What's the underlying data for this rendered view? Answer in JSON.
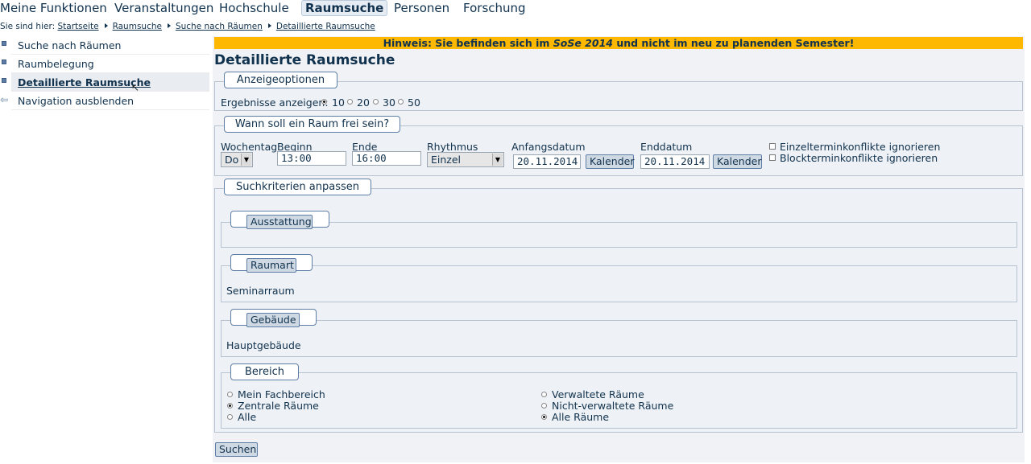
{
  "topnav": {
    "items": [
      "Meine Funktionen",
      "Veranstaltungen",
      "Hochschule",
      "Raumsuche",
      "Personen",
      "Forschung"
    ],
    "active": "Raumsuche"
  },
  "breadcrumb": {
    "prefix": "Sie sind hier:",
    "items": [
      "Startseite",
      "Raumsuche",
      "Suche nach Räumen",
      "Detaillierte Raumsuche"
    ]
  },
  "sidebar": {
    "items": [
      {
        "label": "Suche nach Räumen"
      },
      {
        "label": "Raumbelegung"
      },
      {
        "label": "Detaillierte Raumsuche"
      },
      {
        "label": "Navigation ausblenden"
      }
    ]
  },
  "notice": {
    "prefix": "Hinweis: Sie befinden sich im ",
    "semester": "SoSe 2014",
    "suffix": " und nicht im neu zu planenden Semester!"
  },
  "page_title": "Detaillierte Raumsuche",
  "display_options": {
    "legend": "Anzeigeoptionen",
    "label": "Ergebnisse anzeigen:",
    "options": [
      "10",
      "20",
      "30",
      "50"
    ],
    "selected": "10"
  },
  "when": {
    "legend": "Wann soll ein Raum frei sein?",
    "weekday_label": "Wochentag",
    "weekday_value": "Do",
    "begin_label": "Beginn",
    "begin_value": "13:00",
    "end_label": "Ende",
    "end_value": "16:00",
    "rhythm_label": "Rhythmus",
    "rhythm_value": "Einzel",
    "start_date_label": "Anfangsdatum",
    "start_date_value": "20.11.2014",
    "end_date_label": "Enddatum",
    "end_date_value": "20.11.2014",
    "calendar_button": "Kalender",
    "ignore_single": "Einzelterminkonflikte ignorieren",
    "ignore_block": "Blockterminkonflikte ignorieren"
  },
  "criteria": {
    "legend": "Suchkriterien anpassen",
    "equipment_button": "Ausstattung",
    "room_type_button": "Raumart",
    "room_type_value": "Seminarraum",
    "building_button": "Gebäude",
    "building_value": "Hauptgebäude",
    "area_legend": "Bereich",
    "area_left": [
      "Mein Fachbereich",
      "Zentrale Räume",
      "Alle"
    ],
    "area_left_selected": "Zentrale Räume",
    "area_right": [
      "Verwaltete Räume",
      "Nicht-verwaltete Räume",
      "Alle Räume"
    ],
    "area_right_selected": "Alle Räume"
  },
  "search_button": "Suchen"
}
